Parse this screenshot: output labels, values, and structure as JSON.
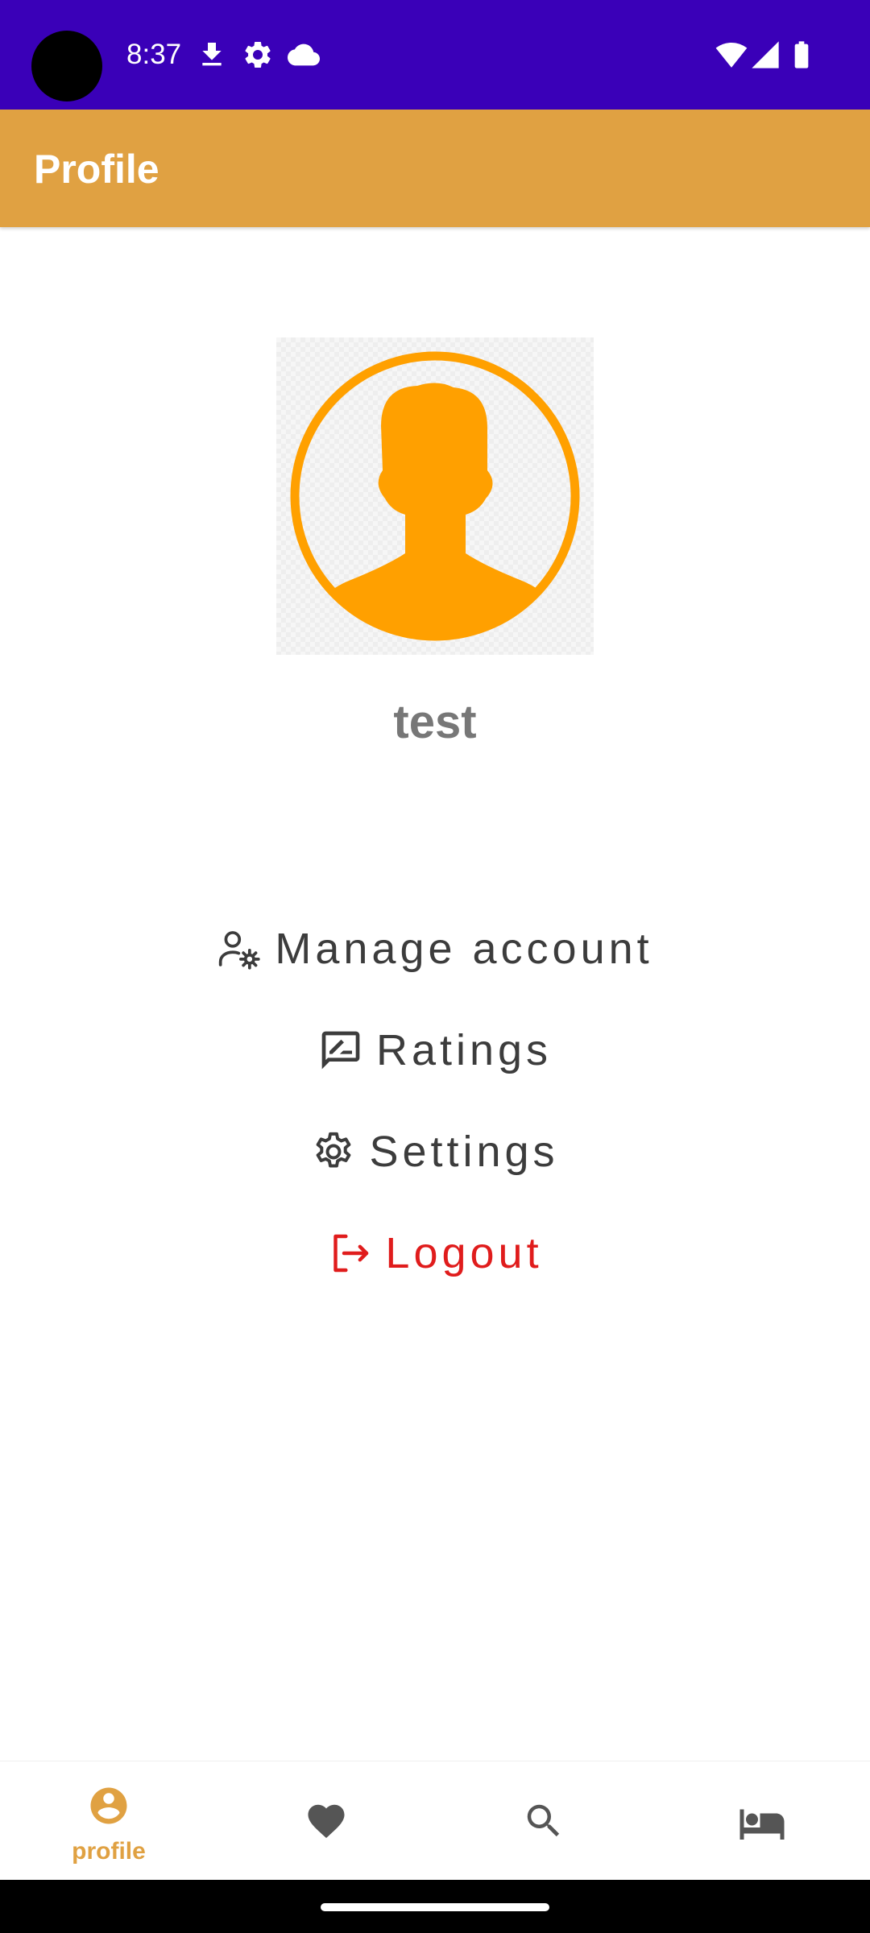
{
  "status_bar": {
    "time": "8:37",
    "left_icons": [
      "download-icon",
      "settings-gear-icon",
      "cloud-icon"
    ],
    "right_icons": [
      "wifi-icon",
      "signal-icon",
      "battery-icon"
    ]
  },
  "app_bar": {
    "title": "Profile"
  },
  "profile": {
    "avatar_icon": "user-avatar-icon",
    "username": "test"
  },
  "menu": {
    "manage_account": {
      "label": "Manage account",
      "icon": "user-gear-icon"
    },
    "ratings": {
      "label": "Ratings",
      "icon": "rate-review-icon"
    },
    "settings": {
      "label": "Settings",
      "icon": "gear-icon"
    },
    "logout": {
      "label": "Logout",
      "icon": "logout-icon"
    }
  },
  "bottom_nav": {
    "items": [
      {
        "label": "profile",
        "icon": "account-circle-icon",
        "active": true
      },
      {
        "icon": "heart-icon",
        "active": false
      },
      {
        "icon": "search-icon",
        "active": false
      },
      {
        "icon": "bed-icon",
        "active": false
      }
    ]
  },
  "colors": {
    "status_bar": "#3a00b8",
    "app_bar": "#e0a142",
    "avatar": "#ffa000",
    "text_primary": "#3c3c3c",
    "username": "#777777",
    "logout": "#e01c1c",
    "nav_active": "#e0a142",
    "nav_inactive": "#555555"
  }
}
